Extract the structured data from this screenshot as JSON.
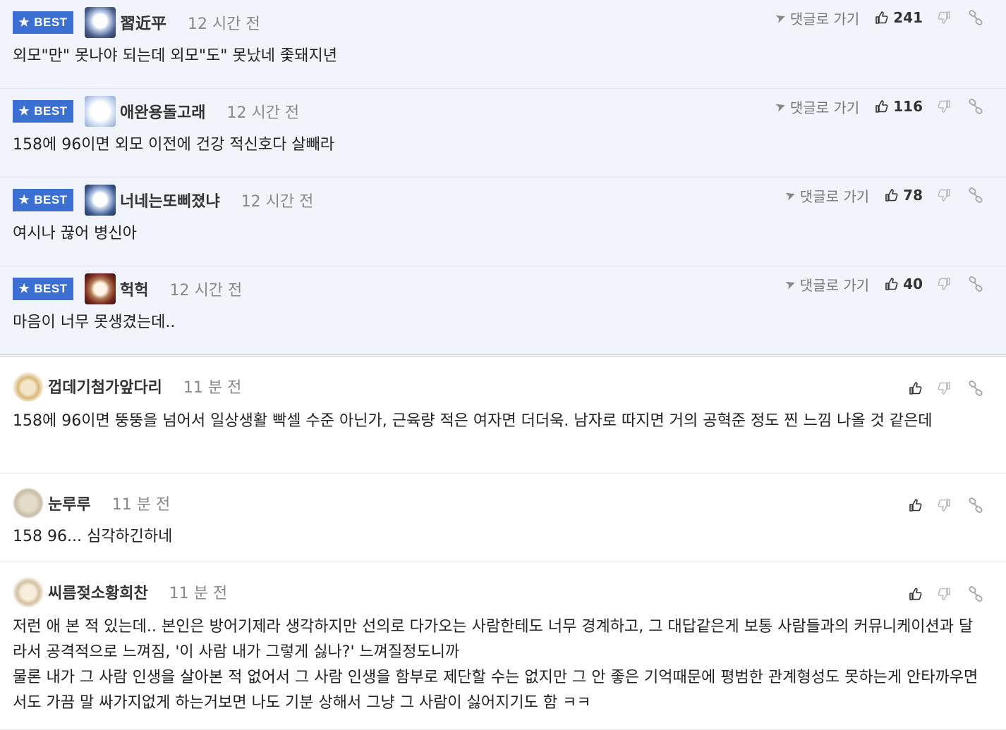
{
  "best_badge": "BEST",
  "goto_label": "댓글로 가기",
  "best_comments": [
    {
      "nick": "習近平",
      "time": "12 시간 전",
      "text": "외모\"만\" 못나야 되는데 외모\"도\" 못났네 좇돼지년",
      "likes": "241",
      "avatar_icon": "dog-avatar-icon"
    },
    {
      "nick": "애완용돌고래",
      "time": "12 시간 전",
      "text": "158에 96이면 외모 이전에 건강 적신호다 살빼라",
      "likes": "116",
      "avatar_icon": "dog-avatar-icon"
    },
    {
      "nick": "너네는또삐졌냐",
      "time": "12 시간 전",
      "text": "여시나 끊어 병신아",
      "likes": "78",
      "avatar_icon": "dog-avatar-icon"
    },
    {
      "nick": "헉헉",
      "time": "12 시간 전",
      "text": "마음이 너무 못생겼는데..",
      "likes": "40",
      "avatar_icon": "dog-avatar-icon"
    }
  ],
  "comments": [
    {
      "nick": "껍데기첨가앞다리",
      "time": "11 분 전",
      "text": "158에 96이면 뚱뚱을 넘어서 일상생활 빡셀 수준 아닌가, 근육량 적은 여자면 더더욱. 남자로 따지면 거의 공혁준 정도 찐 느낌 나올 것 같은데",
      "avatar_icon": "chihuahua-avatar-icon"
    },
    {
      "nick": "눈루루",
      "time": "11 분 전",
      "text": "158 96... 심각하긴하네",
      "avatar_icon": "stone-avatar-icon"
    },
    {
      "nick": "씨름젖소황희찬",
      "time": "11 분 전",
      "text": "저런 애 본 적 있는데.. 본인은 방어기제라 생각하지만 선의로 다가오는 사람한테도 너무 경계하고, 그 대답같은게 보통 사람들과의 커뮤니케이션과 달라서 공격적으로 느껴짐, '이 사람 내가 그렇게 싫나?' 느껴질정도니까",
      "text2": "물론 내가 그 사람 인생을 살아본 적 없어서 그 사람 인생을 함부로 제단할 수는 없지만 그 안 좋은 기억때문에 평범한 관계형성도 못하는게 안타까우면서도 가끔 말 싸가지없게 하는거보면 나도 기분 상해서 그냥 그 사람이 싫어지기도 함 ㅋㅋ",
      "avatar_icon": "puppy-avatar-icon"
    }
  ]
}
